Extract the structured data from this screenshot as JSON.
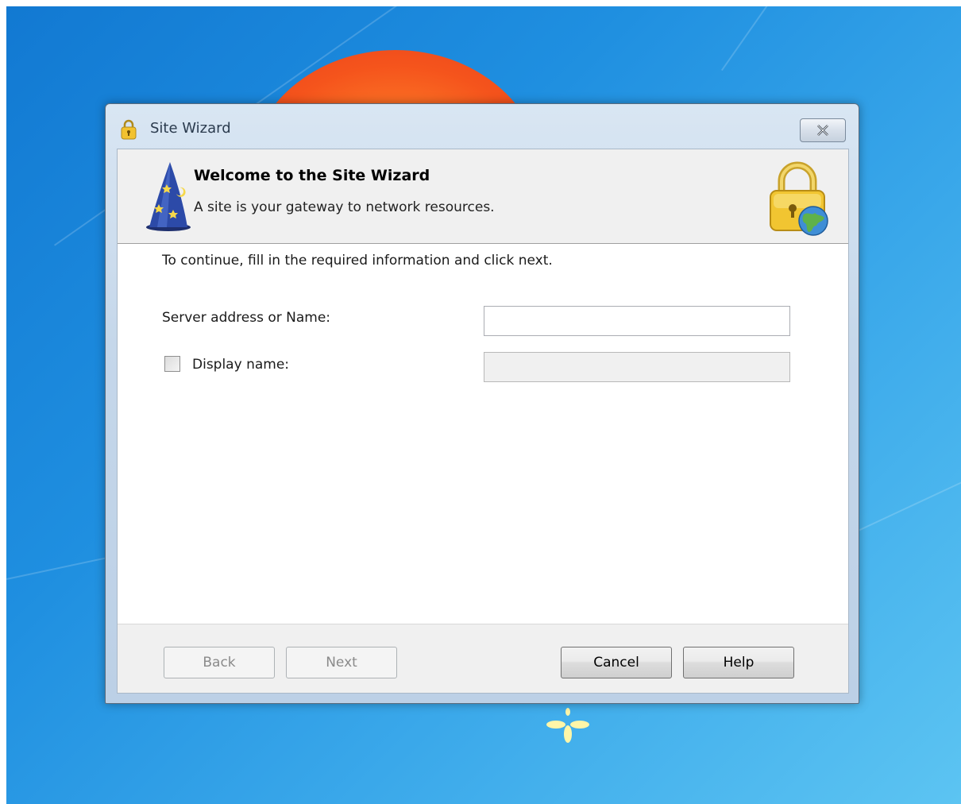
{
  "window": {
    "title": "Site Wizard",
    "close_glyph": "✕"
  },
  "header": {
    "title": "Welcome to the Site Wizard",
    "subtitle": "A site is your gateway to network resources."
  },
  "form": {
    "instructions": "To continue, fill in the required information and click next.",
    "server_label": "Server address or Name:",
    "server_value": "",
    "display_label": "Display name:",
    "display_checked": false,
    "display_value": ""
  },
  "buttons": {
    "back": "Back",
    "next": "Next",
    "cancel": "Cancel",
    "help": "Help"
  },
  "icons": {
    "title": "padlock-icon",
    "header_left": "wizard-hat-icon",
    "header_right": "lock-globe-icon"
  }
}
